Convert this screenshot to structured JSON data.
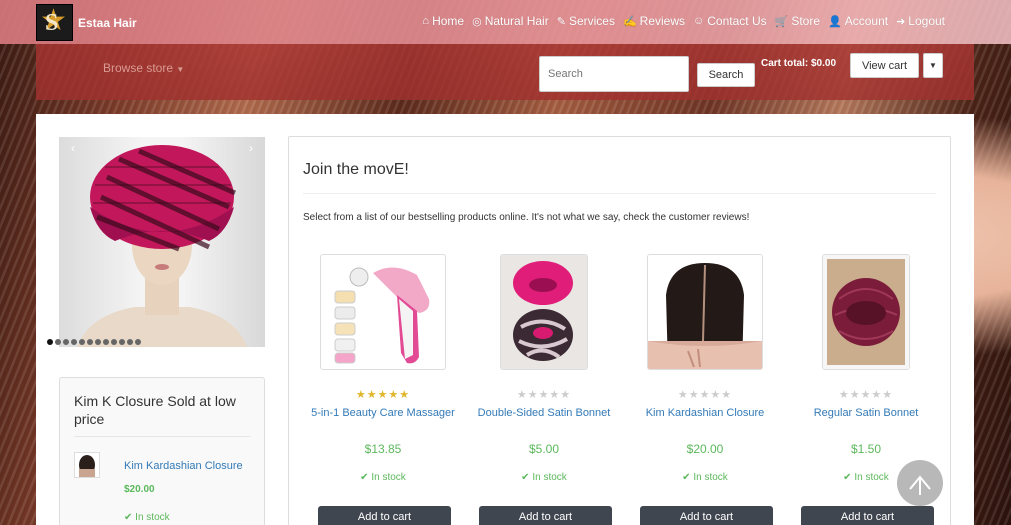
{
  "brand": {
    "name": "Estaa Hair",
    "logo_letter": "S"
  },
  "nav": [
    {
      "label": "Home",
      "icon": "home-icon",
      "glyph": "⌂"
    },
    {
      "label": "Natural Hair",
      "icon": "user-circle-icon",
      "glyph": "◎"
    },
    {
      "label": "Services",
      "icon": "edit-icon",
      "glyph": "✎"
    },
    {
      "label": "Reviews",
      "icon": "pencil-square-icon",
      "glyph": "✍"
    },
    {
      "label": "Contact Us",
      "icon": "smile-icon",
      "glyph": "☺"
    },
    {
      "label": "Store",
      "icon": "cart-icon",
      "glyph": "🛒"
    },
    {
      "label": "Account",
      "icon": "user-icon",
      "glyph": "👤"
    },
    {
      "label": "Logout",
      "icon": "logout-icon",
      "glyph": "➜"
    }
  ],
  "store": {
    "browse_label": "Browse store",
    "search_placeholder": "Search",
    "search_button": "Search",
    "cart_total": "Cart total: $0.00",
    "view_cart": "View cart"
  },
  "carousel": {
    "slide_count": 12,
    "active_index": 0
  },
  "sidebar": {
    "title": "Kim K Closure Sold at low price",
    "item_name": "Kim Kardashian Closure",
    "item_price": "$20.00",
    "item_stock": "In stock"
  },
  "main": {
    "title": "Join the movE!",
    "intro": "Select from a list of our bestselling products online. It's not what we say, check the customer reviews!"
  },
  "products": [
    {
      "name": "5-in-1 Beauty Care Massager",
      "price": "$13.85",
      "stock": "In stock",
      "rating": 5,
      "add_label": "Add to cart",
      "image": "massager"
    },
    {
      "name": "Double-Sided Satin Bonnet",
      "price": "$5.00",
      "stock": "In stock",
      "rating": 0,
      "add_label": "Add to cart",
      "image": "bonnet-pair"
    },
    {
      "name": "Kim Kardashian Closure",
      "price": "$20.00",
      "stock": "In stock",
      "rating": 0,
      "add_label": "Add to cart",
      "image": "closure"
    },
    {
      "name": "Regular Satin Bonnet",
      "price": "$1.50",
      "stock": "In stock",
      "rating": 0,
      "add_label": "Add to cart",
      "image": "bonnet"
    }
  ],
  "colors": {
    "accent_green": "#5cb85c",
    "link_blue": "#337ab7",
    "star_gold": "#e0b62b",
    "button_dark": "#404650"
  }
}
